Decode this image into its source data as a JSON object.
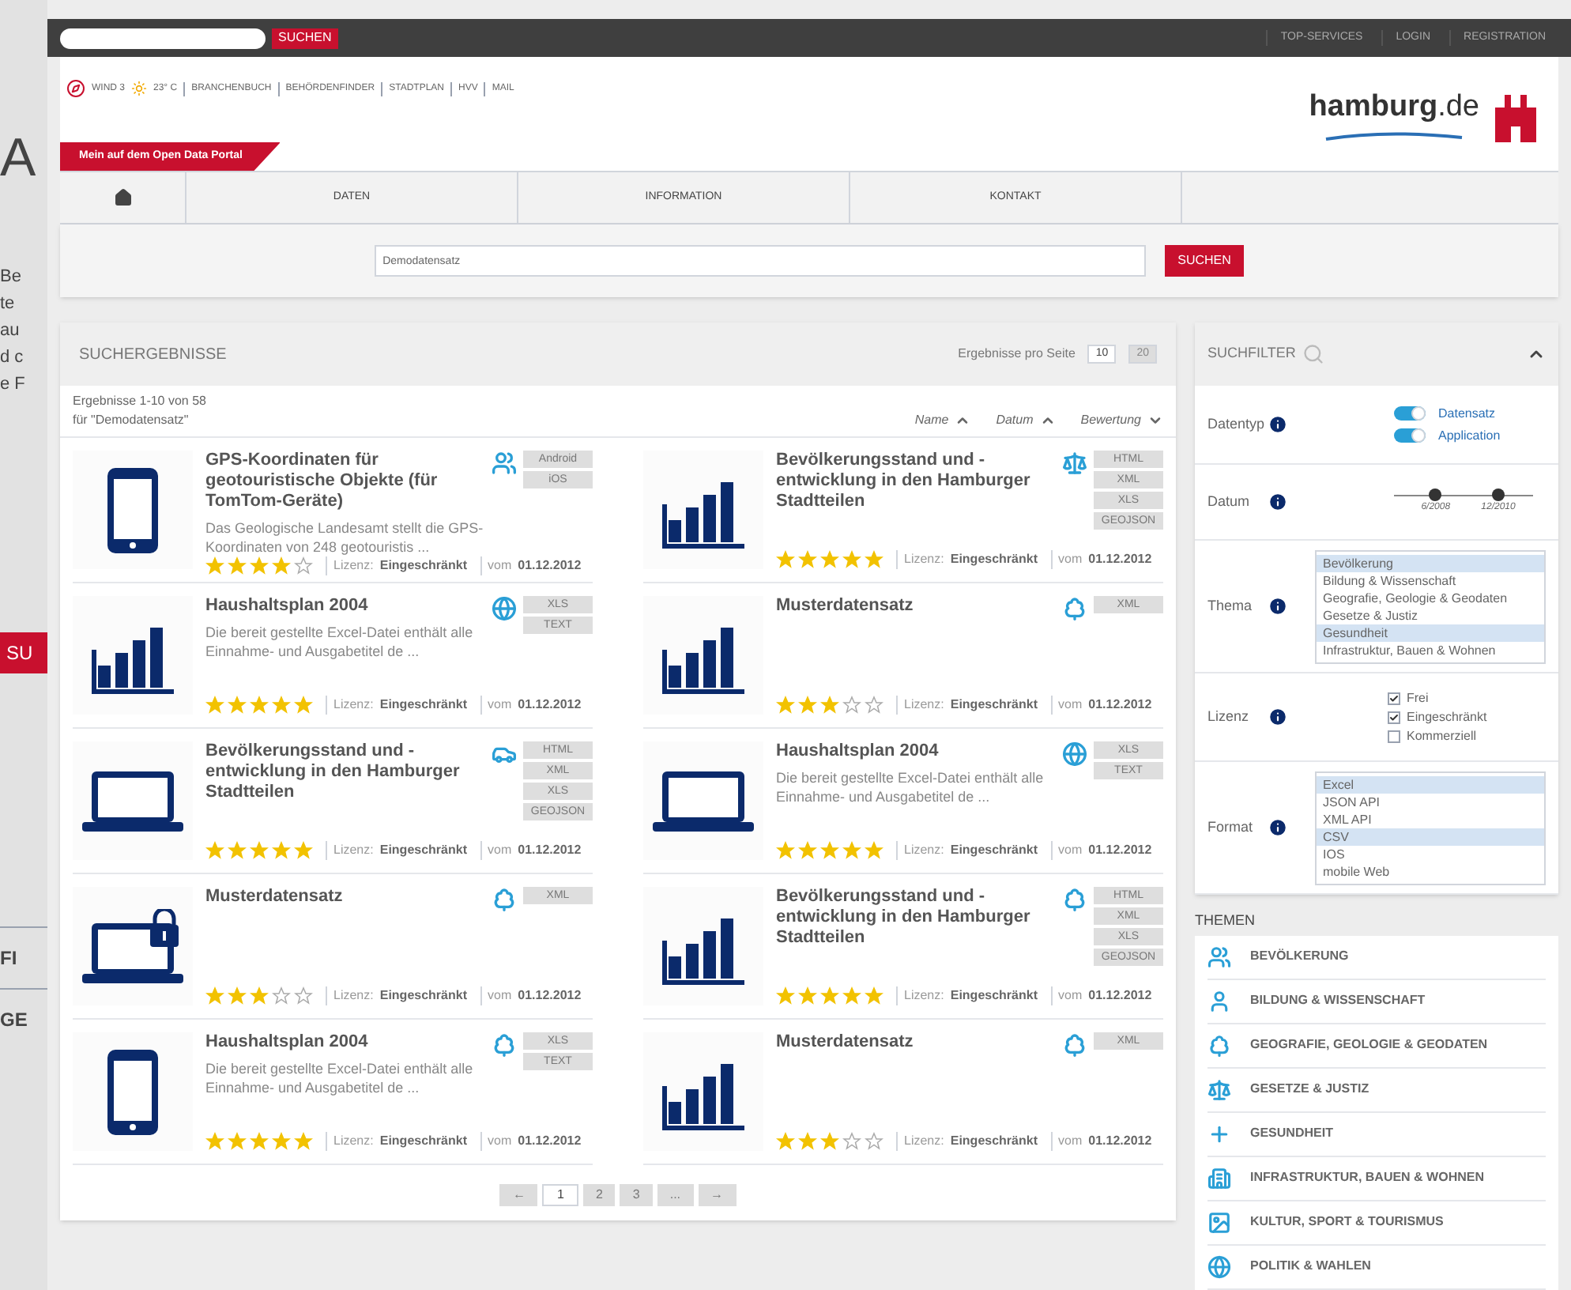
{
  "left_edge": {
    "heading": "A",
    "lines": [
      "Be",
      "te",
      "au",
      "d c",
      "e F"
    ],
    "button": "SU",
    "items": [
      "FI",
      "GE"
    ]
  },
  "topbar": {
    "search_button": "SUCHEN",
    "links": [
      "TOP-SERVICES",
      "LOGIN",
      "REGISTRATION"
    ]
  },
  "header": {
    "wind": "WIND 3",
    "temperature": "23° C",
    "links": [
      "BRANCHENBUCH",
      "BEHÖRDENFINDER",
      "STADTPLAN",
      "HVV",
      "MAIL"
    ],
    "ribbon": "Mein auf dem Open Data Portal",
    "logo": "**hamburg**.de"
  },
  "nav": {
    "items": [
      "DATEN",
      "INFORMATION",
      "KONTAKT"
    ]
  },
  "search": {
    "value": "Demodatensatz",
    "button": "SUCHEN"
  },
  "results": {
    "title": "SUCHERGEBNISSE",
    "per_page_label": "Ergebnisse pro Seite",
    "per_page": [
      {
        "label": "10",
        "selected": true
      },
      {
        "label": "20",
        "selected": false
      }
    ],
    "count": "Ergebnisse 1-10 von 58",
    "query": "für \"Demodatensatz\"",
    "sort": [
      {
        "label": "Name",
        "kind": "ascending"
      },
      {
        "label": "Datum",
        "kind": "ascending"
      },
      {
        "label": "Bewertung",
        "kind": "descending"
      }
    ],
    "items": [
      {
        "kind": "phone",
        "title": "GPS-Koordinaten für geotouristische Objekte (für TomTom-Geräte)",
        "description": "Das Geologische Landesamt stellt die GPS-Koordinaten von 248 geotouristis ...",
        "topic": {
          "kind": "people"
        },
        "formats": [
          "Android",
          "iOS"
        ],
        "stars": 4,
        "license_label": "Lizenz:",
        "license": "Eingeschränkt",
        "date_label": "vom",
        "date": "01.12.2012"
      },
      {
        "kind": "chart",
        "title": "Bevölkerungsstand und -entwicklung in den Hamburger Stadtteilen",
        "topic": {
          "kind": "law"
        },
        "formats": [
          "HTML",
          "XML",
          "XLS",
          "GEOJSON"
        ],
        "stars": 5,
        "license_label": "Lizenz:",
        "license": "Eingeschränkt",
        "date_label": "vom",
        "date": "01.12.2012"
      },
      {
        "kind": "chart",
        "title": "Haushaltsplan 2004",
        "description": "Die bereit gestellte Excel-Datei enthält alle Einnahme- und Ausgabetitel de ...",
        "topic": {
          "kind": "globe"
        },
        "formats": [
          "XLS",
          "TEXT"
        ],
        "stars": 5,
        "license_label": "Lizenz:",
        "license": "Eingeschränkt",
        "date_label": "vom",
        "date": "01.12.2012"
      },
      {
        "kind": "chart",
        "title": "Musterdatensatz",
        "topic": {
          "kind": "tree"
        },
        "formats": [
          "XML"
        ],
        "stars": 3,
        "license_label": "Lizenz:",
        "license": "Eingeschränkt",
        "date_label": "vom",
        "date": "01.12.2012"
      },
      {
        "kind": "laptop",
        "title": "Bevölkerungsstand und -entwicklung in den Hamburger Stadtteilen",
        "topic": {
          "kind": "car"
        },
        "formats": [
          "HTML",
          "XML",
          "XLS",
          "GEOJSON"
        ],
        "stars": 5,
        "license_label": "Lizenz:",
        "license": "Eingeschränkt",
        "date_label": "vom",
        "date": "01.12.2012"
      },
      {
        "kind": "laptop",
        "title": "Haushaltsplan 2004",
        "description": "Die bereit gestellte Excel-Datei enthält alle Einnahme- und Ausgabetitel de ...",
        "topic": {
          "kind": "globe"
        },
        "formats": [
          "XLS",
          "TEXT"
        ],
        "stars": 5,
        "license_label": "Lizenz:",
        "license": "Eingeschränkt",
        "date_label": "vom",
        "date": "01.12.2012"
      },
      {
        "kind": "laptop-lock",
        "title": "Musterdatensatz",
        "topic": {
          "kind": "tree"
        },
        "formats": [
          "XML"
        ],
        "stars": 3,
        "license_label": "Lizenz:",
        "license": "Eingeschränkt",
        "date_label": "vom",
        "date": "01.12.2012"
      },
      {
        "kind": "chart",
        "title": "Bevölkerungsstand und -entwicklung in den Hamburger Stadtteilen",
        "topic": {
          "kind": "tree"
        },
        "formats": [
          "HTML",
          "XML",
          "XLS",
          "GEOJSON"
        ],
        "stars": 5,
        "license_label": "Lizenz:",
        "license": "Eingeschränkt",
        "date_label": "vom",
        "date": "01.12.2012"
      },
      {
        "kind": "phone",
        "title": "Haushaltsplan 2004",
        "description": "Die bereit gestellte Excel-Datei enthält alle Einnahme- und Ausgabetitel de ...",
        "topic": {
          "kind": "tree"
        },
        "formats": [
          "XLS",
          "TEXT"
        ],
        "stars": 5,
        "license_label": "Lizenz:",
        "license": "Eingeschränkt",
        "date_label": "vom",
        "date": "01.12.2012"
      },
      {
        "kind": "chart",
        "title": "Musterdatensatz",
        "topic": {
          "kind": "tree"
        },
        "formats": [
          "XML"
        ],
        "stars": 3,
        "license_label": "Lizenz:",
        "license": "Eingeschränkt",
        "date_label": "vom",
        "date": "01.12.2012"
      }
    ],
    "pagination": [
      {
        "label": "←",
        "selected": false
      },
      {
        "label": "1",
        "selected": true
      },
      {
        "label": "2",
        "selected": false
      },
      {
        "label": "3",
        "selected": false
      },
      {
        "label": "...",
        "selected": false
      },
      {
        "label": "→",
        "selected": false
      }
    ]
  },
  "filter": {
    "title": "SUCHFILTER",
    "datentyp": {
      "label": "Datentyp",
      "toggles": [
        {
          "label": "Datensatz",
          "on": true
        },
        {
          "label": "Application",
          "on": true
        }
      ]
    },
    "datum": {
      "label": "Datum",
      "thumbs": [
        {
          "label": "6/2008",
          "level": 0.3
        },
        {
          "label": "12/2010",
          "level": 0.75
        }
      ]
    },
    "thema": {
      "label": "Thema",
      "options": [
        {
          "label": "Bevölkerung",
          "selected": true
        },
        {
          "label": "Bildung & Wissenschaft",
          "selected": false
        },
        {
          "label": "Geografie, Geologie & Geodaten",
          "selected": false
        },
        {
          "label": "Gesetze & Justiz",
          "selected": false
        },
        {
          "label": "Gesundheit",
          "selected": true
        },
        {
          "label": "Infrastruktur, Bauen & Wohnen",
          "selected": false
        }
      ]
    },
    "lizenz": {
      "label": "Lizenz",
      "options": [
        {
          "label": "Frei",
          "checked": true
        },
        {
          "label": "Eingeschränkt",
          "checked": true
        },
        {
          "label": "Kommerziell",
          "checked": false
        }
      ]
    },
    "format": {
      "label": "Format",
      "options": [
        {
          "label": "Excel",
          "selected": true
        },
        {
          "label": "JSON API",
          "selected": false
        },
        {
          "label": "XML API",
          "selected": false
        },
        {
          "label": "CSV",
          "selected": true
        },
        {
          "label": "IOS",
          "selected": false
        },
        {
          "label": "mobile Web",
          "selected": false
        }
      ]
    }
  },
  "themes": {
    "title": "THEMEN",
    "items": [
      {
        "kind": "people",
        "label": "BEVÖLKERUNG"
      },
      {
        "kind": "person",
        "label": "BILDUNG & WISSENSCHAFT"
      },
      {
        "kind": "tree",
        "label": "GEOGRAFIE, GEOLOGIE & GEODATEN"
      },
      {
        "kind": "law",
        "label": "GESETZE & JUSTIZ"
      },
      {
        "kind": "cross",
        "label": "GESUNDHEIT"
      },
      {
        "kind": "building",
        "label": "INFRASTRUKTUR, BAUEN & WOHNEN"
      },
      {
        "kind": "image",
        "label": "KULTUR, SPORT & TOURISMUS"
      },
      {
        "kind": "globe",
        "label": "POLITIK & WAHLEN"
      }
    ]
  }
}
